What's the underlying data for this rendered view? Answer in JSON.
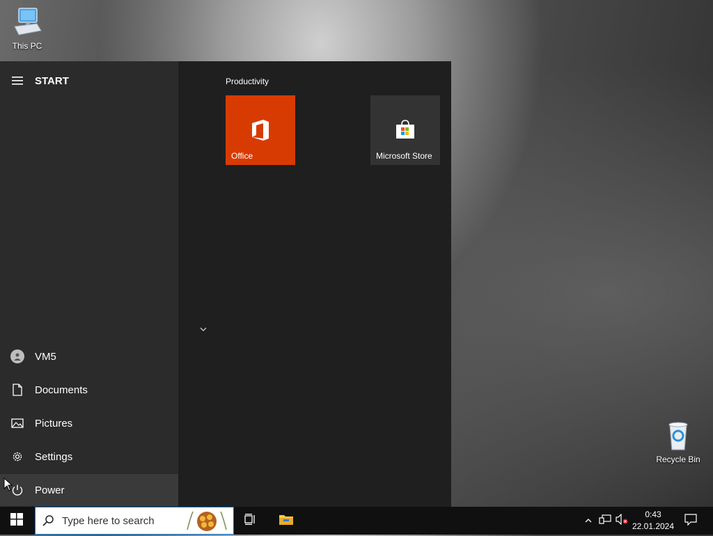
{
  "desktop": {
    "icons": [
      {
        "label": "This PC",
        "icon": "computer-icon"
      },
      {
        "label": "Recycle Bin",
        "icon": "recycle-bin-icon"
      }
    ]
  },
  "start_menu": {
    "title": "START",
    "rail_items": [
      {
        "label": "VM5",
        "icon": "user-avatar-icon"
      },
      {
        "label": "Documents",
        "icon": "document-icon"
      },
      {
        "label": "Pictures",
        "icon": "pictures-icon"
      },
      {
        "label": "Settings",
        "icon": "gear-icon"
      },
      {
        "label": "Power",
        "icon": "power-icon"
      }
    ],
    "group_title": "Productivity",
    "tiles": [
      {
        "label": "Office",
        "icon": "office-icon",
        "color": "#d83b01"
      },
      {
        "label": "Microsoft Store",
        "icon": "store-bag-icon",
        "color": "#333333"
      }
    ]
  },
  "taskbar": {
    "search_placeholder": "Type here to search",
    "clock": {
      "time": "0:43",
      "date": "22.01.2024"
    },
    "accent": "#0078d7"
  }
}
